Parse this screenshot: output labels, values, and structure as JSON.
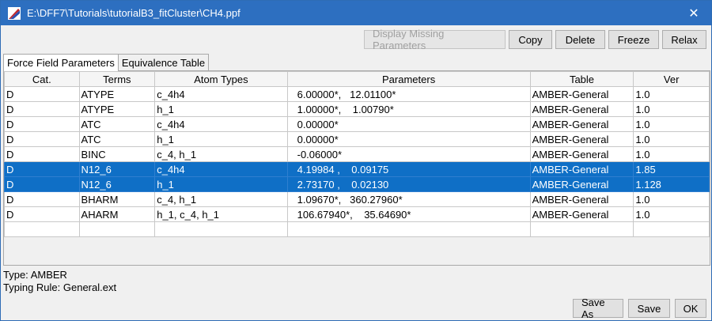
{
  "window": {
    "title": "E:\\DFF7\\Tutorials\\tutorialB3_fitCluster\\CH4.ppf",
    "close_glyph": "✕"
  },
  "toolbar": {
    "display_missing_label": "Display Missing Parameters",
    "copy_label": "Copy",
    "delete_label": "Delete",
    "freeze_label": "Freeze",
    "relax_label": "Relax"
  },
  "tabs": [
    {
      "label": "Force Field Parameters",
      "active": true
    },
    {
      "label": "Equivalence Table",
      "active": false
    }
  ],
  "table": {
    "columns": [
      "Cat.",
      "Terms",
      "Atom Types",
      "Parameters",
      "Table",
      "Ver"
    ],
    "rows": [
      {
        "cat": "D",
        "terms": "ATYPE",
        "atom_types": "c_4h4",
        "parameters": "6.00000*,   12.01100*",
        "table": "AMBER-General",
        "ver": "1.0",
        "selected": false
      },
      {
        "cat": "D",
        "terms": "ATYPE",
        "atom_types": "h_1",
        "parameters": "1.00000*,    1.00790*",
        "table": "AMBER-General",
        "ver": "1.0",
        "selected": false
      },
      {
        "cat": "D",
        "terms": "ATC",
        "atom_types": "c_4h4",
        "parameters": "0.00000*",
        "table": "AMBER-General",
        "ver": "1.0",
        "selected": false
      },
      {
        "cat": "D",
        "terms": "ATC",
        "atom_types": "h_1",
        "parameters": "0.00000*",
        "table": "AMBER-General",
        "ver": "1.0",
        "selected": false
      },
      {
        "cat": "D",
        "terms": "BINC",
        "atom_types": "c_4, h_1",
        "parameters": "-0.06000*",
        "table": "AMBER-General",
        "ver": "1.0",
        "selected": false
      },
      {
        "cat": "D",
        "terms": "N12_6",
        "atom_types": "c_4h4",
        "parameters": "4.19984 ,    0.09175",
        "table": "AMBER-General",
        "ver": "1.85",
        "selected": true
      },
      {
        "cat": "D",
        "terms": "N12_6",
        "atom_types": "h_1",
        "parameters": "2.73170 ,    0.02130",
        "table": "AMBER-General",
        "ver": "1.128",
        "selected": true
      },
      {
        "cat": "D",
        "terms": "BHARM",
        "atom_types": "c_4, h_1",
        "parameters": "1.09670*,   360.27960*",
        "table": "AMBER-General",
        "ver": "1.0",
        "selected": false
      },
      {
        "cat": "D",
        "terms": "AHARM",
        "atom_types": "h_1, c_4, h_1",
        "parameters": "106.67940*,    35.64690*",
        "table": "AMBER-General",
        "ver": "1.0",
        "selected": false
      },
      {
        "cat": "",
        "terms": "",
        "atom_types": "",
        "parameters": "",
        "table": "",
        "ver": "",
        "selected": false
      }
    ]
  },
  "status": {
    "type_text": "Type: AMBER",
    "typing_rule_text": "Typing Rule: General.ext"
  },
  "bottom": {
    "save_as_label": "Save As",
    "save_label": "Save",
    "ok_label": "OK"
  },
  "colors": {
    "titlebar": "#2d6fc0",
    "selection": "#0f6fc6"
  }
}
